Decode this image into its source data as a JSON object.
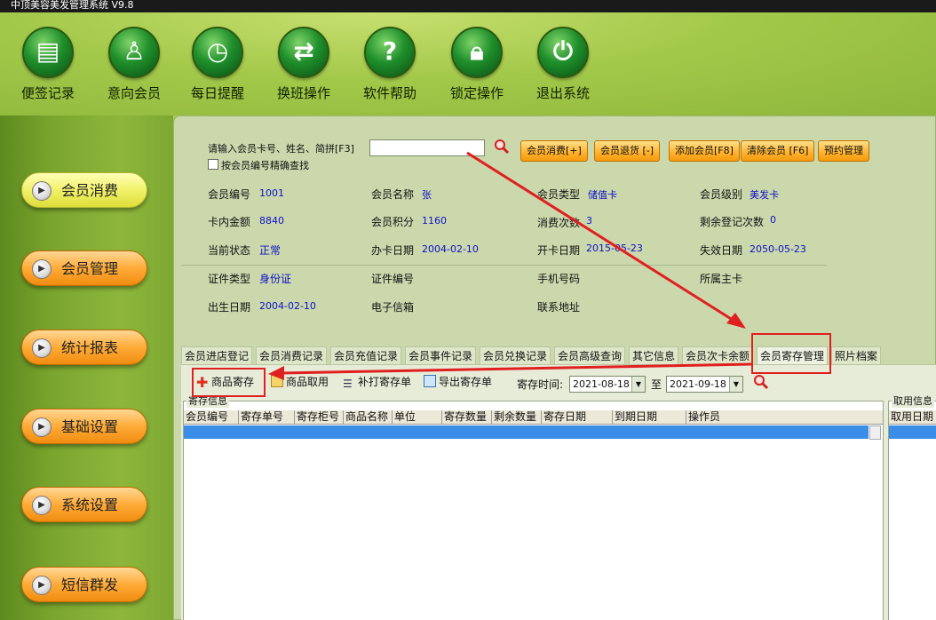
{
  "window": {
    "title": "中顶美容美发管理系统 V9.8"
  },
  "toolbar": {
    "items": [
      {
        "label": "便签记录",
        "icon": "note-icon"
      },
      {
        "label": "意向会员",
        "icon": "person-icon"
      },
      {
        "label": "每日提醒",
        "icon": "alarm-clock-icon"
      },
      {
        "label": "换班操作",
        "icon": "swap-arrows-icon"
      },
      {
        "label": "软件帮助",
        "icon": "help-icon"
      },
      {
        "label": "锁定操作",
        "icon": "lock-icon"
      },
      {
        "label": "退出系统",
        "icon": "power-icon"
      }
    ]
  },
  "sidebar": {
    "items": [
      {
        "label": "会员消费",
        "style": "yellow"
      },
      {
        "label": "会员管理",
        "style": "orange"
      },
      {
        "label": "统计报表",
        "style": "orange"
      },
      {
        "label": "基础设置",
        "style": "orange"
      },
      {
        "label": "系统设置",
        "style": "orange"
      },
      {
        "label": "短信群发",
        "style": "orange"
      }
    ]
  },
  "search": {
    "label": "请输入会员卡号、姓名、简拼[F3]",
    "value": "",
    "exact_match_label": "按会员编号精确查找"
  },
  "actions": {
    "consume": "会员消费[+]",
    "return": "会员退货 [-]",
    "add": "添加会员[F8]",
    "clear": "清除会员 [F6]",
    "booking": "预约管理"
  },
  "member": {
    "id_label": "会员编号",
    "id": "1001",
    "name_label": "会员名称",
    "name": "张",
    "type_label": "会员类型",
    "type": "储值卡",
    "level_label": "会员级别",
    "level": "美发卡",
    "balance_label": "卡内金额",
    "balance": "8840",
    "points_label": "会员积分",
    "points": "1160",
    "visits_label": "消费次数",
    "visits": "3",
    "remaining_label": "剩余登记次数",
    "remaining": "0",
    "status_label": "当前状态",
    "status": "正常",
    "issue_label": "办卡日期",
    "issue": "2004-02-10",
    "open_label": "开卡日期",
    "open": "2015-05-23",
    "expire_label": "失效日期",
    "expire": "2050-05-23",
    "idtype_label": "证件类型",
    "idtype": "身份证",
    "idno_label": "证件编号",
    "phone_label": "手机号码",
    "owner_label": "所属主卡",
    "birth_label": "出生日期",
    "birth": "2004-02-10",
    "email_label": "电子信箱",
    "address_label": "联系地址"
  },
  "tabs": [
    "会员进店登记",
    "会员消费记录",
    "会员充值记录",
    "会员事件记录",
    "会员兑换记录",
    "会员高级查询",
    "其它信息",
    "会员次卡余额",
    "会员寄存管理",
    "照片档案"
  ],
  "active_tab": "会员寄存管理",
  "storage": {
    "add_btn": "商品寄存",
    "take_btn": "商品取用",
    "reprint_btn": "补打寄存单",
    "export_btn": "导出寄存单",
    "time_label": "寄存时间:",
    "date_from": "2021-08-18",
    "to_label": "至",
    "date_to": "2021-09-18",
    "group_title": "寄存信息",
    "columns": [
      "会员编号",
      "寄存单号",
      "寄存柜号",
      "商品名称",
      "单位",
      "寄存数量",
      "剩余数量",
      "寄存日期",
      "到期日期",
      "操作员"
    ],
    "take_group_title": "取用信息",
    "take_columns": [
      "取用日期"
    ]
  },
  "colors": {
    "highlight": "#e02020",
    "selected_row": "#3a8ee8",
    "value_text": "#1010c8"
  }
}
